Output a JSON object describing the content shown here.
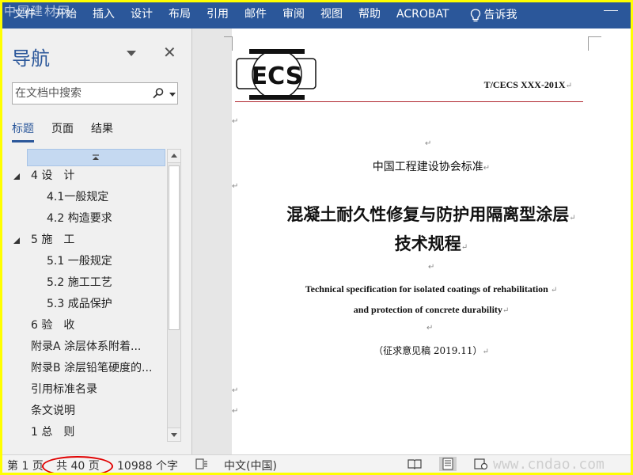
{
  "watermark_top": "中国建材网",
  "ribbon": {
    "tabs": [
      "文件",
      "开始",
      "插入",
      "设计",
      "布局",
      "引用",
      "邮件",
      "审阅",
      "视图",
      "帮助",
      "ACROBAT"
    ],
    "tell_me": "告诉我"
  },
  "nav": {
    "title": "导航",
    "search_placeholder": "在文档中搜索",
    "tabs": [
      "标题",
      "页面",
      "结果"
    ],
    "headings": [
      {
        "text": "4 设　计",
        "level": 1,
        "expanded": true
      },
      {
        "text": "4.1一般规定",
        "level": 2
      },
      {
        "text": "4.2 构造要求",
        "level": 2
      },
      {
        "text": "5 施　工",
        "level": 1,
        "expanded": true
      },
      {
        "text": "5.1 一般规定",
        "level": 2
      },
      {
        "text": "5.2 施工工艺",
        "level": 2
      },
      {
        "text": "5.3 成品保护",
        "level": 2
      },
      {
        "text": "6 验　收",
        "level": 1
      },
      {
        "text": "附录A 涂层体系附着...",
        "level": 1
      },
      {
        "text": "附录B 涂层铅笔硬度的...",
        "level": 1
      },
      {
        "text": "引用标准名录",
        "level": 1
      },
      {
        "text": "条文说明",
        "level": 1
      },
      {
        "text": "1 总　则",
        "level": 1
      }
    ]
  },
  "document": {
    "logo_text": "ECS",
    "standard_code": "T/CECS XXX-201X",
    "association": "中国工程建设协会标准",
    "title_line1": "混凝土耐久性修复与防护用隔离型涂层",
    "title_line2": "技术规程",
    "english_line1": "Technical specification for isolated coatings of rehabilitation",
    "english_line2": "and protection of concrete durability",
    "draft_note": "（征求意见稿 2019.11）",
    "paragraph_mark": "↵"
  },
  "status": {
    "page": "第 1 页",
    "total": "共 40 页",
    "words": "10988 个字",
    "language": "中文(中国)"
  },
  "watermark_bottom": "www.cndao.com",
  "colors": {
    "ribbon": "#2b579a",
    "accent": "#2b579a",
    "highlight": "#e00000"
  }
}
